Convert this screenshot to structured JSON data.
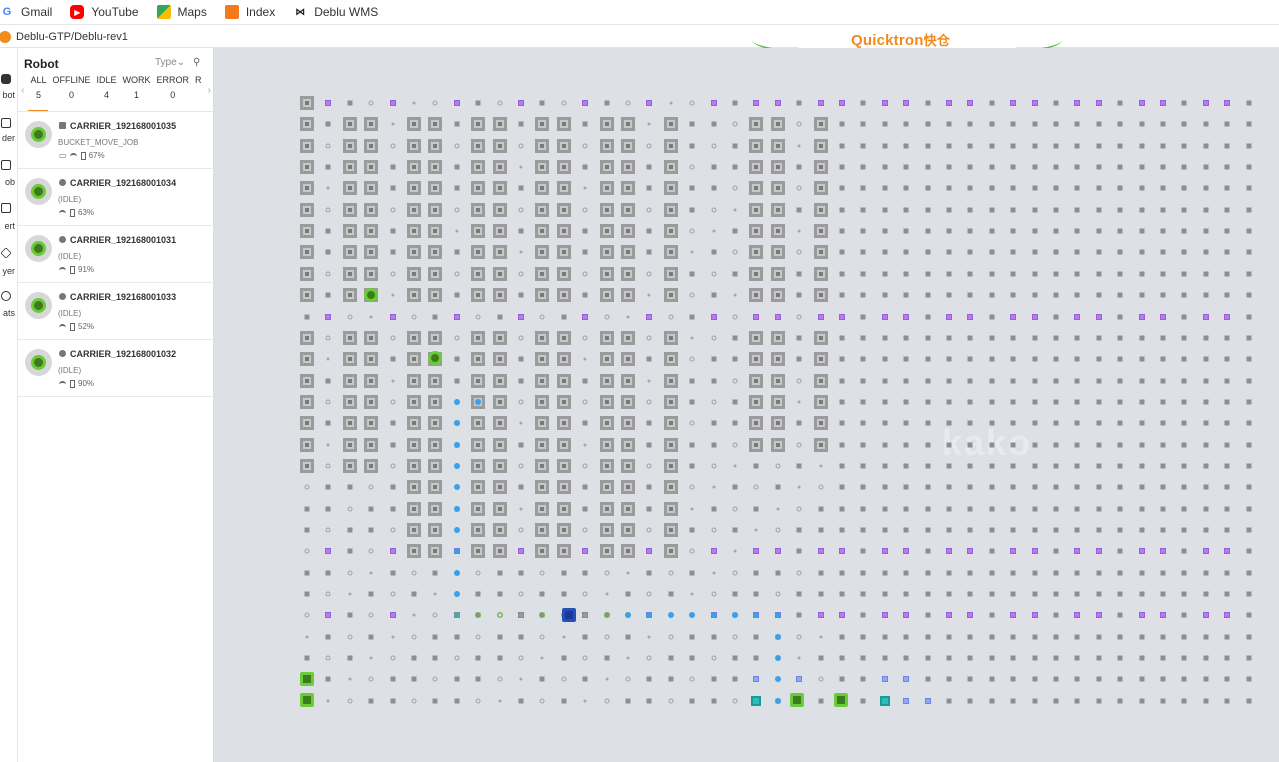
{
  "bookmarks": [
    {
      "label": "Gmail",
      "icon": "google-icon"
    },
    {
      "label": "YouTube",
      "icon": "youtube-icon"
    },
    {
      "label": "Maps",
      "icon": "maps-icon"
    },
    {
      "label": "Index",
      "icon": "index-icon"
    },
    {
      "label": "Deblu WMS",
      "icon": "bow-icon"
    }
  ],
  "breadcrumb": "Deblu-GTP/Deblu-rev1",
  "brand": {
    "latin": "Quicktron",
    "cjk": "快仓"
  },
  "watermark": "kako",
  "rail": {
    "items": [
      "bot",
      "der",
      "ob",
      "ert",
      "yer",
      "ats"
    ]
  },
  "panel": {
    "title": "Robot",
    "type_label": "Type",
    "tabs": [
      {
        "label": "ALL",
        "count": "5"
      },
      {
        "label": "OFFLINE",
        "count": "0"
      },
      {
        "label": "IDLE",
        "count": "4"
      },
      {
        "label": "WORK",
        "count": "1"
      },
      {
        "label": "ERROR",
        "count": "0"
      },
      {
        "label": "R",
        "count": ""
      }
    ],
    "robots": [
      {
        "name": "CARRIER_192168001035",
        "status": "BUCKET_MOVE_JOB",
        "battery": "67%"
      },
      {
        "name": "CARRIER_192168001034",
        "status": "(IDLE)",
        "battery": "63%"
      },
      {
        "name": "CARRIER_192168001031",
        "status": "(IDLE)",
        "battery": "91%"
      },
      {
        "name": "CARRIER_192168001033",
        "status": "(IDLE)",
        "battery": "52%"
      },
      {
        "name": "CARRIER_192168001032",
        "status": "(IDLE)",
        "battery": "90%"
      }
    ]
  },
  "colors": {
    "accent": "#f08a1e",
    "map_bg": "#dde1e6",
    "robot_green": "#6ccb3b",
    "path_blue": "#3aa0e8",
    "station_purple": "#b67de6"
  }
}
